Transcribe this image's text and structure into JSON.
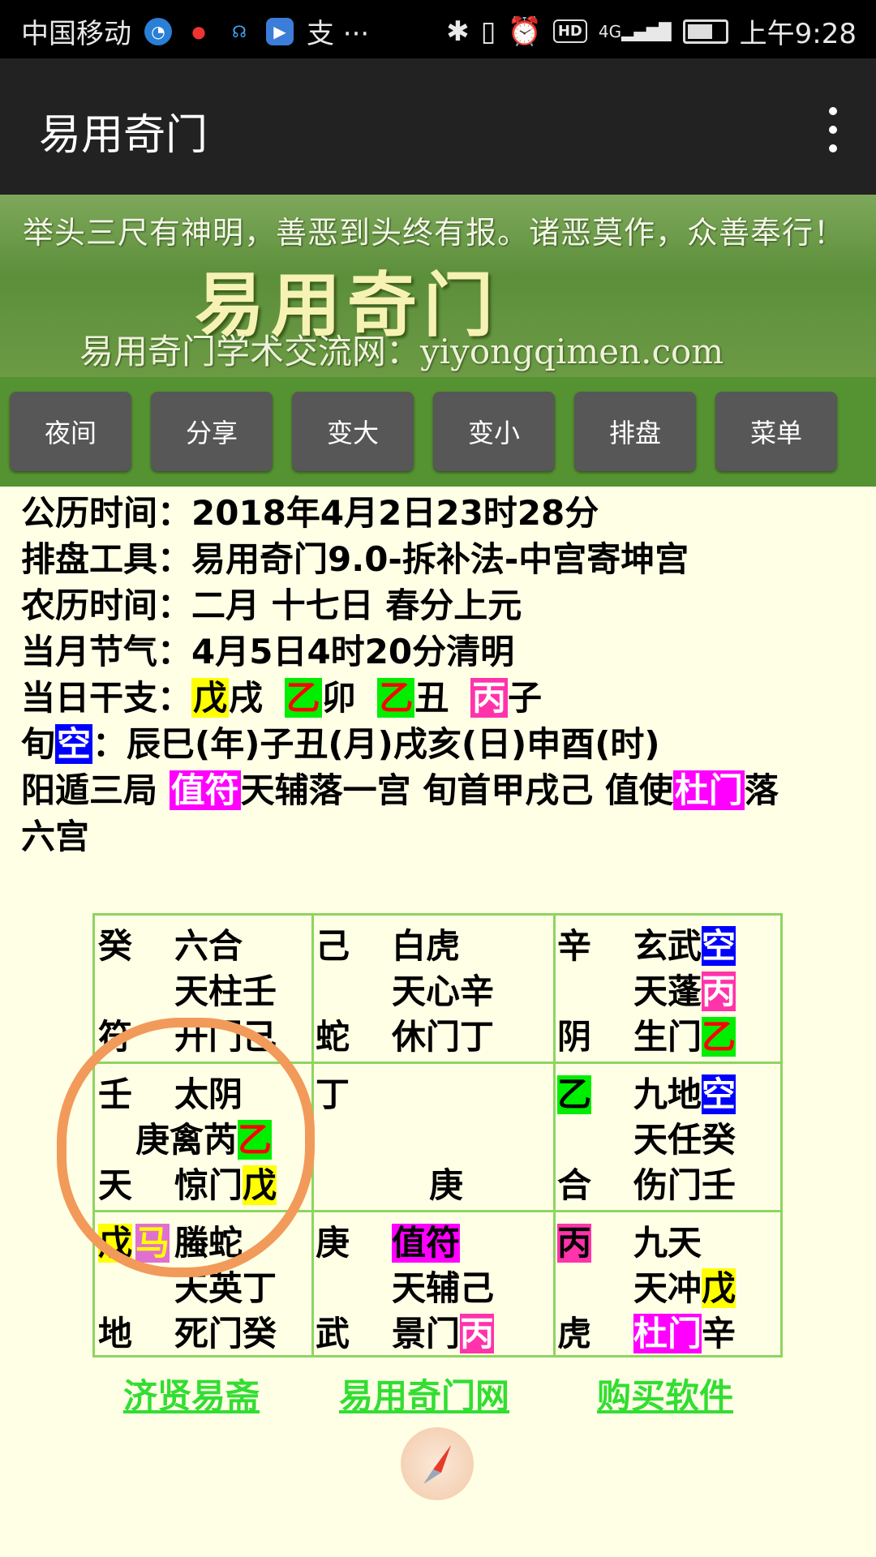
{
  "status_bar": {
    "carrier": "中国移动",
    "more": "支 ···",
    "network": "4G",
    "hd": "HD",
    "time": "上午9:28"
  },
  "app_bar": {
    "title": "易用奇门"
  },
  "banner": {
    "motto": "举头三尺有神明，善恶到头终有报。诸恶莫作，众善奉行！",
    "logo_text": "易用奇门",
    "subtitle": "易用奇门学术交流网：yiyongqimen.com"
  },
  "toolbar": {
    "buttons": [
      "夜间",
      "分享",
      "变大",
      "变小",
      "排盘",
      "菜单"
    ]
  },
  "info": {
    "solar_label": "公历时间：",
    "solar_value": "2018年4月2日23时28分",
    "tool_label": "排盘工具：",
    "tool_value": "易用奇门9.0-拆补法-中宫寄坤宫",
    "lunar_label": "农历时间：",
    "lunar_value": "二月 十七日 春分上元",
    "term_label": "当月节气：",
    "term_value": "4月5日4时20分清明",
    "ganzhi_label": "当日干支：",
    "ganzhi": [
      {
        "hl": "戊",
        "rest": "戌"
      },
      {
        "hl": "乙",
        "rest": "卯"
      },
      {
        "hl": "乙",
        "rest": "丑"
      },
      {
        "hl": "丙",
        "rest": "子"
      }
    ],
    "xunkong_prefix": "旬",
    "xunkong_hl": "空",
    "xunkong_value": "：辰巳(年)子丑(月)戌亥(日)申酉(时)",
    "ju_text": "阳遁三局 ",
    "zhifu": "值符",
    "luo_text": "天辅落一宫 旬首甲戌己 值使",
    "zhishi": "杜门",
    "luo2": "落",
    "luo3": "六宫"
  },
  "grid": {
    "top_left": {
      "stem": "癸",
      "god": "六合",
      "star_line": "天柱壬",
      "shen": "符",
      "door_line": "开门己"
    },
    "top_mid": {
      "stem": "己",
      "god": "白虎",
      "star_line": "天心辛",
      "shen": "蛇",
      "door_line": "休门丁"
    },
    "top_right": {
      "stem": "辛",
      "god": "玄武",
      "god_hl": "空",
      "star": "天蓬",
      "star_hl": "丙",
      "shen": "阴",
      "door": "生门",
      "door_hl": "乙"
    },
    "mid_left": {
      "stem": "壬",
      "god": "太阴",
      "star": "庚禽芮",
      "star_hl": "乙",
      "shen": "天",
      "door": "惊门",
      "door_hl": "戊"
    },
    "mid_mid": {
      "stem": "丁",
      "center": "庚"
    },
    "mid_right": {
      "stem_hl": "乙",
      "god": "九地",
      "god_hl": "空",
      "star_line": "天任癸",
      "shen": "合",
      "door_line": "伤门壬"
    },
    "bot_left": {
      "stem_hl": "戊",
      "ma": "马",
      "god": "螣蛇",
      "star_line": "天英丁",
      "shen": "地",
      "door_line": "死门癸"
    },
    "bot_mid": {
      "stem": "庚",
      "god_hl": "值符",
      "star_line": "天辅己",
      "shen": "武",
      "door": "景门",
      "door_hl": "丙"
    },
    "bot_right": {
      "stem_hl": "丙",
      "god": "九天",
      "star": "天冲",
      "star_hl": "戊",
      "shen": "虎",
      "door_hl": "杜门",
      "door": "辛"
    }
  },
  "links": [
    "济贤易斋",
    "易用奇门网",
    "购买软件"
  ],
  "colors": {
    "page_bg": "#ffffe6",
    "app_bar": "#222222",
    "button_bar": "#559231",
    "button": "#575757",
    "grid_line": "#8fd462",
    "link": "#33dd33",
    "annotation_circle": "#f29a5a"
  }
}
